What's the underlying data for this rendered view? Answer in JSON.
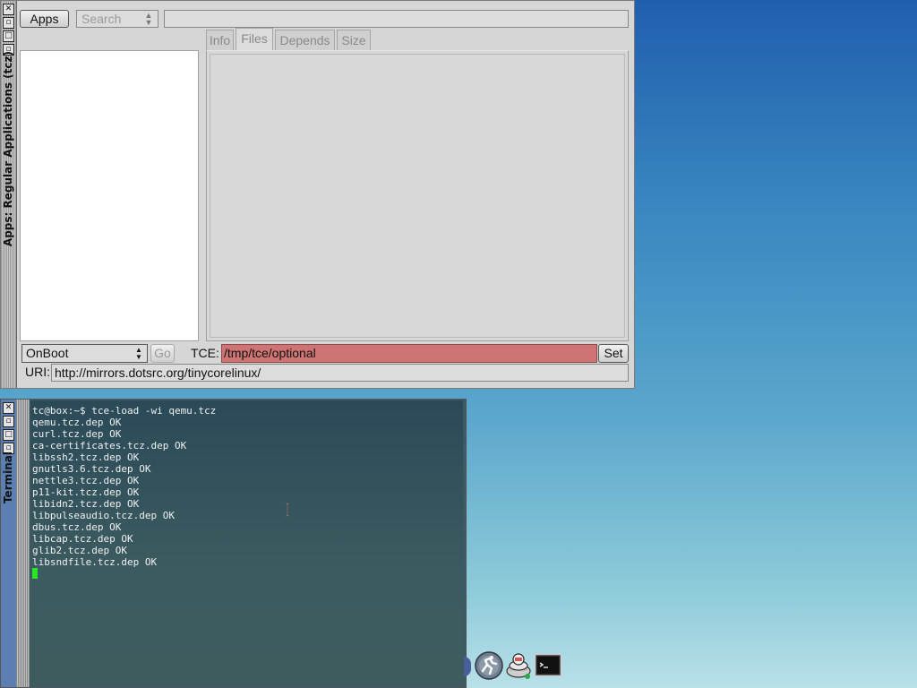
{
  "apps_window": {
    "title": "Apps: Regular Applications (tcz)",
    "apps_button": "Apps",
    "search_placeholder": "Search",
    "tabs": [
      "Info",
      "Files",
      "Depends",
      "Size"
    ],
    "active_tab": "Files",
    "onboot_value": "OnBoot",
    "go_label": "Go",
    "tce_label": "TCE:",
    "tce_value": "/tmp/tce/optional",
    "set_label": "Set",
    "uri_label": "URI:",
    "uri_value": "http://mirrors.dotsrc.org/tinycorelinux/"
  },
  "terminal": {
    "title": "Terminal",
    "lines": [
      "tc@box:~$ tce-load -wi qemu.tcz",
      "qemu.tcz.dep OK",
      "curl.tcz.dep OK",
      "ca-certificates.tcz.dep OK",
      "libssh2.tcz.dep OK",
      "gnutls3.6.tcz.dep OK",
      "nettle3.tcz.dep OK",
      "p11-kit.tcz.dep OK",
      "libidn2.tcz.dep OK",
      "libpulseaudio.tcz.dep OK",
      "dbus.tcz.dep OK",
      "libcap.tcz.dep OK",
      "glib2.tcz.dep OK",
      "libsndfile.tcz.dep OK"
    ]
  },
  "window_buttons": [
    "close",
    "iconify",
    "maximize",
    "menu"
  ],
  "dock": [
    "apps-icon",
    "run-icon",
    "control-panel-icon",
    "terminal-icon"
  ],
  "colors": {
    "tce_field": "#cf7474",
    "cursor": "#26e826",
    "titlebar_active": "#5b7fb0"
  }
}
